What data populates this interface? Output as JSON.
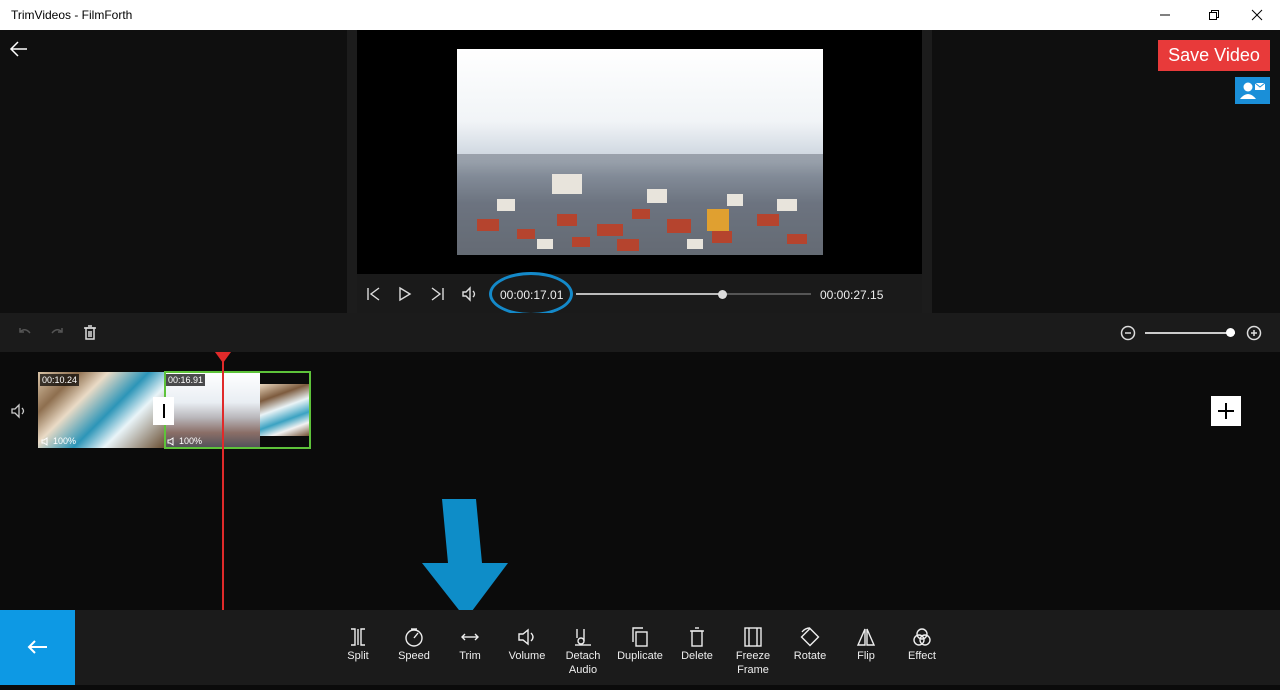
{
  "window": {
    "title": "TrimVideos - FilmForth"
  },
  "header": {
    "save_label": "Save Video"
  },
  "player": {
    "current_time": "00:00:17.01",
    "total_time": "00:00:27.15",
    "progress": 0.62
  },
  "timeline": {
    "zoom_level": 0.94,
    "playhead_time": "00:00:17.01",
    "clips": [
      {
        "duration": "00:10.24",
        "volume": "100%"
      },
      {
        "duration": "00:16.91",
        "volume": "100%",
        "selected": true
      }
    ]
  },
  "tools": [
    {
      "label": "Split",
      "icon": "split-icon"
    },
    {
      "label": "Speed",
      "icon": "speed-icon"
    },
    {
      "label": "Trim",
      "icon": "trim-icon"
    },
    {
      "label": "Volume",
      "icon": "volume-icon"
    },
    {
      "label": "Detach Audio",
      "icon": "detach-audio-icon"
    },
    {
      "label": "Duplicate",
      "icon": "duplicate-icon"
    },
    {
      "label": "Delete",
      "icon": "delete-icon"
    },
    {
      "label": "Freeze Frame",
      "icon": "freeze-frame-icon"
    },
    {
      "label": "Rotate",
      "icon": "rotate-icon"
    },
    {
      "label": "Flip",
      "icon": "flip-icon"
    },
    {
      "label": "Effect",
      "icon": "effect-icon"
    }
  ],
  "colors": {
    "save_button": "#e83a3a",
    "accent_blue": "#0d99e4",
    "selection_green": "#5ec33a",
    "playhead_red": "#e02a2a",
    "annotation_blue": "#1489c9"
  }
}
